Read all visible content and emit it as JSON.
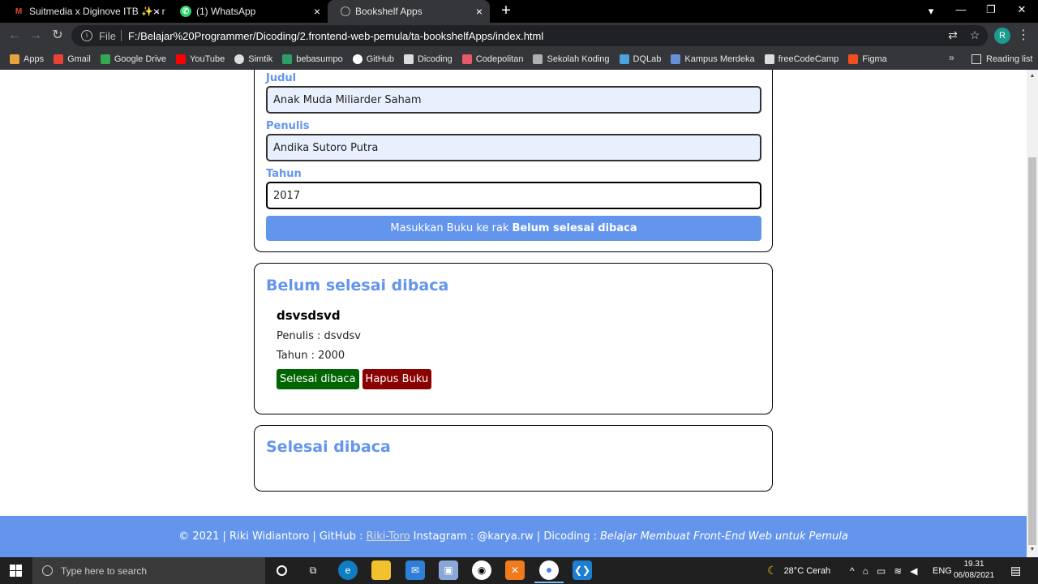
{
  "browser": {
    "tabs": [
      {
        "title": "Suitmedia  x  Diginove ITB ✨ - r",
        "icon": "gmail-icon",
        "active": false
      },
      {
        "title": "(1) WhatsApp",
        "icon": "whatsapp-icon",
        "active": false
      },
      {
        "title": "Bookshelf Apps",
        "icon": "globe-icon",
        "active": true
      }
    ],
    "address": {
      "scheme_label": "File",
      "url": "F:/Belajar%20Programmer/Dicoding/2.frontend-web-pemula/ta-bookshelfApps/index.html"
    },
    "profile_initial": "R",
    "bookmarks": [
      {
        "label": "Apps",
        "color": "#e8a33d"
      },
      {
        "label": "Gmail",
        "color": "#ea4335"
      },
      {
        "label": "Google Drive",
        "color": "#34a853"
      },
      {
        "label": "YouTube",
        "color": "#ff0000"
      },
      {
        "label": "Simtik",
        "color": "#dddddd"
      },
      {
        "label": "bebasumpo",
        "color": "#2e9e6a"
      },
      {
        "label": "GitHub",
        "color": "#ffffff"
      },
      {
        "label": "Dicoding",
        "color": "#dddddd"
      },
      {
        "label": "Codepolitan",
        "color": "#e8596c"
      },
      {
        "label": "Sekolah Koding",
        "color": "#b0b0b0"
      },
      {
        "label": "DQLab",
        "color": "#4aa3df"
      },
      {
        "label": "Kampus Merdeka",
        "color": "#6a8fd6"
      },
      {
        "label": "freeCodeCamp",
        "color": "#dddddd"
      },
      {
        "label": "Figma",
        "color": "#f24e1e"
      }
    ],
    "more_bookmarks": "»",
    "reading_list": "Reading list"
  },
  "form": {
    "title_label": "Judul",
    "title_value": "Anak  Muda Miliarder Saham",
    "author_label": "Penulis",
    "author_value": "Andika Sutoro Putra",
    "year_label": "Tahun",
    "year_value": "2017",
    "submit_prefix": "Masukkan Buku ke rak",
    "submit_target": "Belum selesai dibaca"
  },
  "unread_shelf": {
    "heading": "Belum selesai dibaca",
    "books": [
      {
        "title": "dsvsdsvd",
        "author_line": "Penulis : dsvdsv",
        "year_line": "Tahun : 2000",
        "done_button": "Selesai dibaca",
        "delete_button": "Hapus Buku"
      }
    ]
  },
  "read_shelf": {
    "heading": "Selesai dibaca"
  },
  "footer": {
    "prefix": "© 2021 | Riki Widiantoro | GitHub :",
    "github_link": "Riki-Toro",
    "middle": "Instagram : @karya.rw | Dicoding :",
    "course": "Belajar Membuat Front-End Web untuk Pemula"
  },
  "taskbar": {
    "search_placeholder": "Type here to search",
    "weather": "28°C  Cerah",
    "language": "ENG",
    "time": "19.31",
    "date": "06/08/2021"
  },
  "colors": {
    "accent": "#6495ed",
    "done_button": "#006400",
    "delete_button": "#8b0000"
  }
}
